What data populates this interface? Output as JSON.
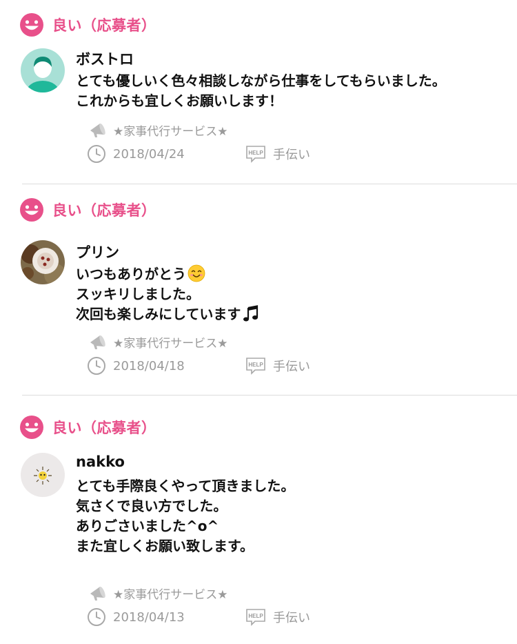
{
  "reviews": [
    {
      "rating": "良い（応募者）",
      "username": "ボストロ",
      "avatar": "default-person-avatar",
      "comment": [
        "とても優しいく色々相談しながら仕事をしてもらいました。",
        "これからも宜しくお願いします！"
      ],
      "service": "★家事代行サービス★",
      "date": "2018/04/24",
      "category": "手伝い"
    },
    {
      "rating": "良い（応募者）",
      "username": "プリン",
      "avatar": "food-photo-avatar",
      "comment": [
        "いつもありがとう",
        "スッキリしました。",
        "次回も楽しみにしています"
      ],
      "comment_emoji": [
        "smiling-face-emoji",
        "musical-note-emoji"
      ],
      "service": "★家事代行サービス★",
      "date": "2018/04/18",
      "category": "手伝い"
    },
    {
      "rating": "良い（応募者）",
      "username": "nakko",
      "avatar": "character-avatar",
      "comment": [
        "とても手際良くやって頂きました。",
        "気さくで良い方でした。",
        "ありごさいました^o^",
        "また宜しくお願い致します。"
      ],
      "service": "★家事代行サービス★",
      "date": "2018/04/13",
      "category": "手伝い"
    }
  ],
  "colors": {
    "rating_pink": "#e8508a",
    "meta_gray": "#9a9a9a",
    "avatar_teal": "#a8e0d6",
    "avatar_green": "#1fb89a"
  }
}
